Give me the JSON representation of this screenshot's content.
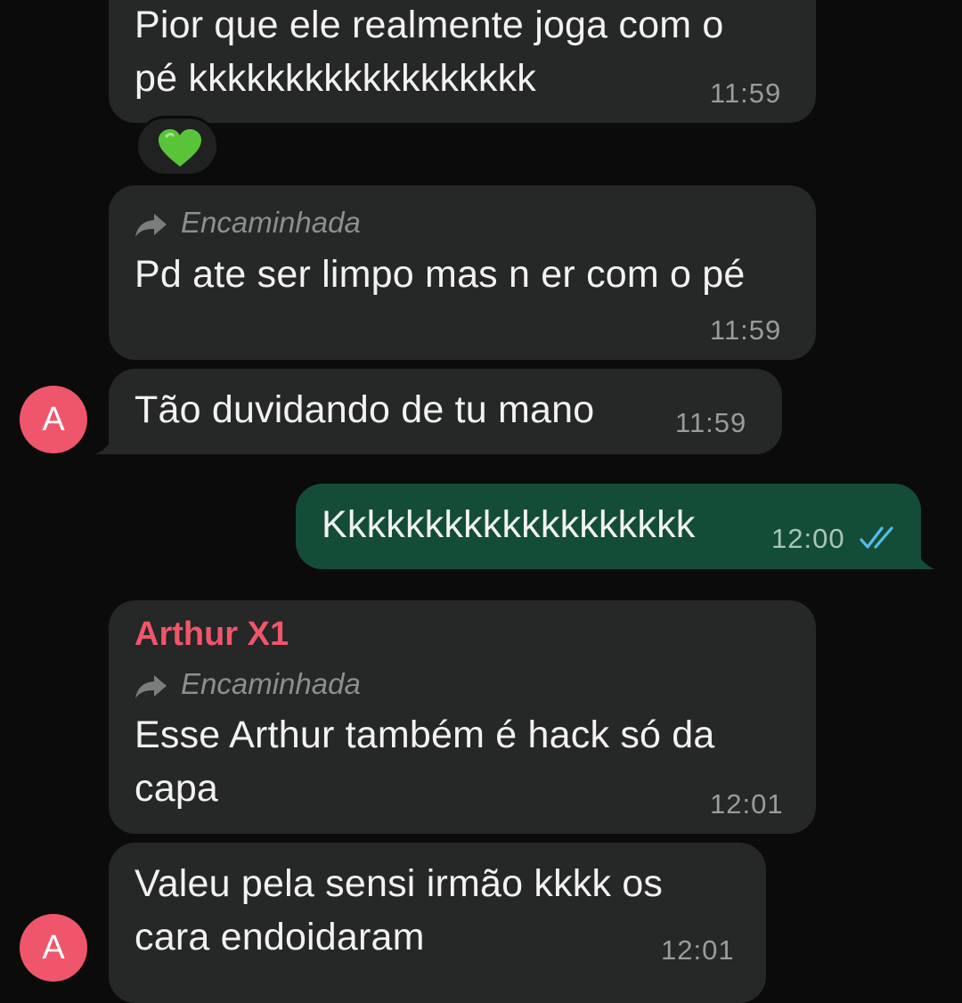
{
  "messages": [
    {
      "id": "m1",
      "direction": "incoming",
      "lines": [
        "Pior que ele realmente joga com o",
        "pé kkkkkkkkkkkkkkkkkk"
      ],
      "time": "11:59",
      "reaction": "green-heart"
    },
    {
      "id": "m2",
      "direction": "incoming",
      "forwarded_label": "Encaminhada",
      "lines": [
        "Pd ate ser limpo mas n er com o pé"
      ],
      "time": "11:59"
    },
    {
      "id": "m3",
      "direction": "incoming",
      "avatar_letter": "A",
      "lines": [
        "Tão duvidando de tu mano"
      ],
      "time": "11:59"
    },
    {
      "id": "m4",
      "direction": "outgoing",
      "lines": [
        "Kkkkkkkkkkkkkkkkkkk"
      ],
      "time": "12:00",
      "status": "read"
    },
    {
      "id": "m5",
      "direction": "incoming",
      "sender": "Arthur X1",
      "forwarded_label": "Encaminhada",
      "lines": [
        "Esse Arthur também é hack só da",
        "capa"
      ],
      "time": "12:01"
    },
    {
      "id": "m6",
      "direction": "incoming",
      "avatar_letter": "A",
      "lines": [
        "Valeu pela sensi irmão kkkk os",
        "cara endoidaram"
      ],
      "time": "12:01"
    }
  ],
  "icons": {
    "forward": "forward-arrow-icon",
    "read_receipt": "double-check-icon",
    "reaction": "green-heart-icon"
  },
  "colors": {
    "background": "#0b0b0b",
    "incoming_bubble": "#262727",
    "outgoing_bubble": "#144d37",
    "sender_name": "#f0566b",
    "avatar": "#f0566b",
    "read_ticks": "#53bdeb",
    "heart": "#59c43a"
  }
}
